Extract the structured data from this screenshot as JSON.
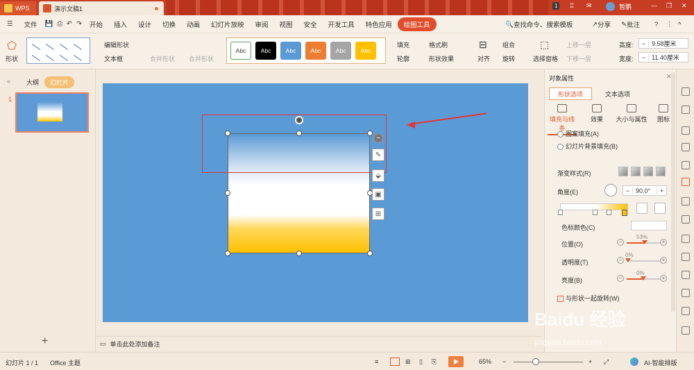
{
  "titlebar": {
    "app_name": "WPS",
    "doc_name": "演示文稿1",
    "badge_count": "1",
    "user": "暂鹏"
  },
  "menubar": {
    "file": "文件",
    "items": [
      "开始",
      "插入",
      "设计",
      "切换",
      "动画",
      "幻灯片放映",
      "审阅",
      "视图",
      "安全",
      "开发工具",
      "特色应用"
    ],
    "active": "绘图工具",
    "search": "查找命令、搜索模板",
    "share": "分享",
    "comment": "批注"
  },
  "ribbon": {
    "shape": "形状",
    "edit_shape": "编辑形状",
    "text_box": "文本框",
    "merge_shape": "合并形状",
    "merge_shape2": "合并形状",
    "style_labels": [
      "Abc",
      "Abc",
      "Abc",
      "Abc",
      "Abc",
      "Abc"
    ],
    "fill": "填充",
    "format_brush": "格式刷",
    "outline": "轮廓",
    "shape_effect": "形状效果",
    "align": "对齐",
    "group": "组合",
    "rotate": "旋转",
    "selection_pane": "选择窗格",
    "bring_forward": "上移一层",
    "send_backward": "下移一层",
    "height_label": "高度:",
    "height_value": "9.58厘米",
    "width_label": "宽度:",
    "width_value": "11.40厘米"
  },
  "left_panel": {
    "outline_tab": "大纲",
    "slide_tab": "幻灯片",
    "slide_number": "1",
    "add_slide": "+"
  },
  "notes": {
    "placeholder": "单击此处添加备注"
  },
  "right_panel": {
    "title": "对象属性",
    "tab_shape": "形状选项",
    "tab_text": "文本选项",
    "subtabs": [
      "填充与线条",
      "效果",
      "大小与属性",
      "图标"
    ],
    "opt_pattern_fill": "图案填充(A)",
    "opt_bg_fill": "幻灯片背景填充(B)",
    "gradient_style": "渐变样式(R)",
    "angle_label": "角度(E)",
    "angle_value": "90.0°",
    "stop_color_label": "色标颜色(C)",
    "position_label": "位置(O)",
    "position_value": "53%",
    "transparency_label": "透明度(T)",
    "transparency_value": "0%",
    "brightness_label": "亮度(B)",
    "brightness_value": "0%",
    "rotate_with_shape": "与形状一起旋转(W)"
  },
  "statusbar": {
    "slide_info": "幻灯片 1 / 1",
    "theme": "Office 主题",
    "zoom": "65%",
    "ai_label": "AI-智能排版"
  },
  "watermark": {
    "main": "Baidu 经验",
    "sub": "jingyan.baidu.com"
  },
  "colors": {
    "title_bar": "#c73d24",
    "accent": "#e24c2a",
    "slide_bg": "#5b9bd5",
    "annotation": "#e53333",
    "gradient_gold": "#ffc000"
  }
}
